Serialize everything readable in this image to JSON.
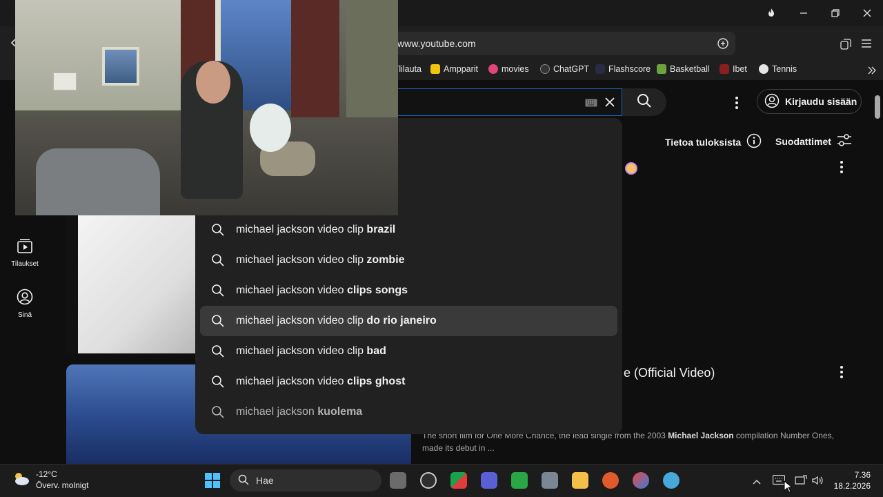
{
  "browser": {
    "url": "www.youtube.com",
    "bookmarks": [
      "Ylilauta",
      "Ampparit",
      "movies",
      "ChatGPT",
      "Flashscore",
      "Basketball",
      "Ibet",
      "Tennis"
    ]
  },
  "youtube": {
    "signin_label": "Kirjaudu sisään",
    "results_info": "Tietoa tuloksista",
    "filters_label": "Suodattimet",
    "sidebar": {
      "subscriptions": "Tilaukset",
      "you": "Sinä"
    },
    "suggestions": [
      {
        "prefix": "michael jackson video clip ",
        "bold": "brazil"
      },
      {
        "prefix": "michael jackson video clip ",
        "bold": "zombie"
      },
      {
        "prefix": "michael jackson video ",
        "bold": "clips songs"
      },
      {
        "prefix": "michael jackson video clip ",
        "bold": "do rio janeiro"
      },
      {
        "prefix": "michael jackson video clip ",
        "bold": "bad"
      },
      {
        "prefix": "michael jackson video ",
        "bold": "clips ghost"
      },
      {
        "prefix": "michael jackson ",
        "bold": "kuolema"
      }
    ],
    "video_title_tail": "e (Official Video)",
    "description": {
      "part1": "The short film for  One More Chance,  the lead single from the 2003 ",
      "bold": "Michael Jackson",
      "part2": " compilation Number Ones, made its debut in ..."
    }
  },
  "taskbar": {
    "weather_temp": "-12°C",
    "weather_desc": "Överv. molnigt",
    "search_placeholder": "Hae",
    "time": "7.36",
    "date": "18.2.2026"
  },
  "colors": {
    "accent_blue": "#1c62b9",
    "yt_bg": "#0f0f0f"
  }
}
